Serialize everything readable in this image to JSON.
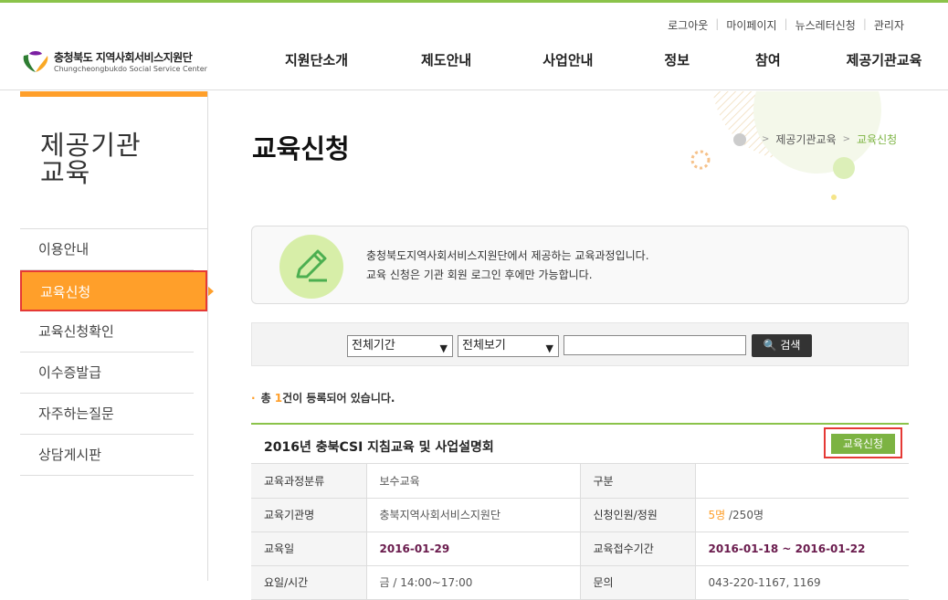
{
  "util_nav": [
    "로그아웃",
    "마이페이지",
    "뉴스레터신청",
    "관리자"
  ],
  "logo": {
    "name_ko": "충청북도 지역사회서비스지원단",
    "name_en": "Chungcheongbukdo Social Service Center"
  },
  "gnb": [
    "지원단소개",
    "제도안내",
    "사업안내",
    "정보",
    "참여",
    "제공기관교육"
  ],
  "lnb": {
    "title_line1": "제공기관",
    "title_line2": "교육",
    "items": [
      "이용안내",
      "교육신청",
      "교육신청확인",
      "이수증발급",
      "자주하는질문",
      "상담게시판"
    ]
  },
  "page": {
    "title": "교육신청"
  },
  "breadcrumb": {
    "level1": "제공기관교육",
    "current": "교육신청"
  },
  "info": {
    "line1": "충청북도지역사회서비스지원단에서 제공하는 교육과정입니다.",
    "line2": "교육 신청은 기관 회원 로그인 후에만 가능합니다."
  },
  "search": {
    "period": "전체기간",
    "view": "전체보기",
    "button": "검색",
    "query": ""
  },
  "count": {
    "prefix": "총 ",
    "num": "1",
    "suffix": "건이 등록되어 있습니다."
  },
  "course": {
    "title": "2016년 충북CSI 지침교육 및 사업설명회",
    "apply_label": "교육신청",
    "rows": [
      {
        "l1": "교육과정분류",
        "v1": "보수교육",
        "l2": "구분",
        "v2": ""
      },
      {
        "l1": "교육기관명",
        "v1": "충북지역사회서비스지원단",
        "l2": "신청인원/정원",
        "v2a": "5명",
        "v2b": " /250명"
      },
      {
        "l1": "교육일",
        "v1": "2016-01-29",
        "l2": "교육접수기간",
        "v2": "2016-01-18 ~ 2016-01-22"
      },
      {
        "l1": "요일/시간",
        "v1": "금 / 14:00~17:00",
        "l2": "문의",
        "v2": "043-220-1167, 1169"
      }
    ]
  },
  "colors": {
    "accent_green": "#7cb342",
    "accent_orange": "#ff9f2a",
    "highlight_red": "#e53935"
  }
}
